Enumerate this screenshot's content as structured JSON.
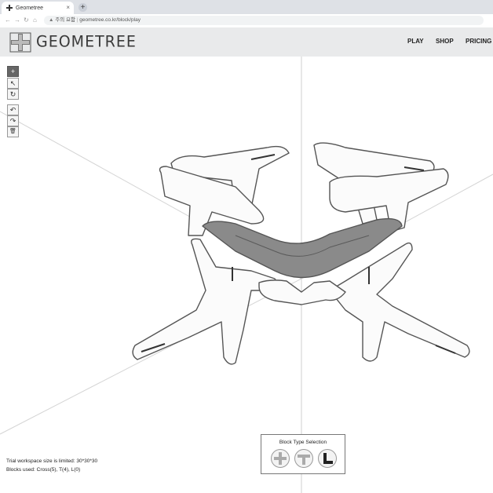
{
  "browser": {
    "tab_title": "Geometree",
    "new_tab": "+",
    "url": "geometree.co.kr/block/play",
    "security_label": "주의 요함"
  },
  "header": {
    "logo_text": "GEOMETREE",
    "nav": [
      "PLAY",
      "SHOP",
      "PRICING"
    ]
  },
  "toolbar": {
    "icons": [
      "add-icon",
      "select-cursor-icon",
      "rotate-icon",
      "undo-icon",
      "redo-icon",
      "delete-icon"
    ],
    "glyphs": [
      "+",
      "↖",
      "↻",
      "↶",
      "↷",
      "🗑"
    ]
  },
  "status": {
    "workspace_note": "Trial workspace size is limited: 30*30*30",
    "blocks_used": "Blocks used: Cross(5), T(4), L(0)"
  },
  "block_type_selection": {
    "title": "Block Type Selection",
    "options": [
      "cross-block-icon",
      "t-block-icon",
      "l-block-icon"
    ],
    "selected": "l-block-icon"
  }
}
